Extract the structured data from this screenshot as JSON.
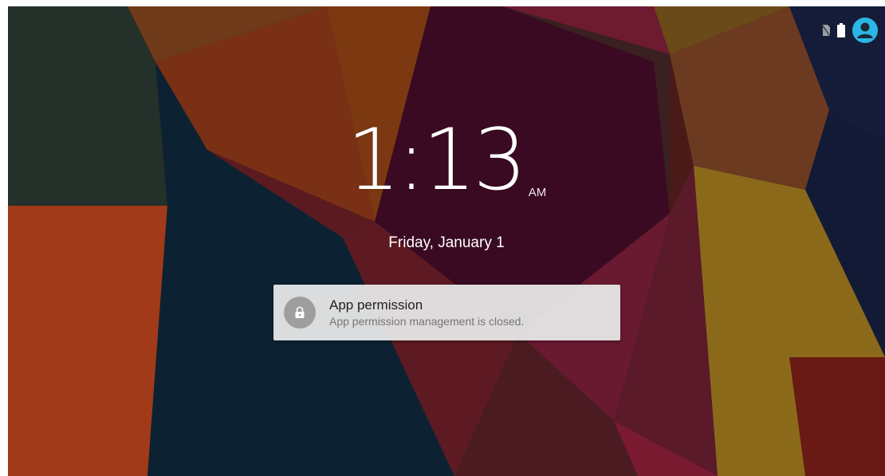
{
  "status_bar": {
    "icons": [
      "no-sim-icon",
      "battery-icon",
      "user-account-icon"
    ],
    "accent_color": "#2ab7e5"
  },
  "lock_screen": {
    "time": "1:13",
    "ampm": "AM",
    "date": "Friday, January 1"
  },
  "notification": {
    "icon": "lock-icon",
    "title": "App permission",
    "body": "App permission management is closed."
  }
}
